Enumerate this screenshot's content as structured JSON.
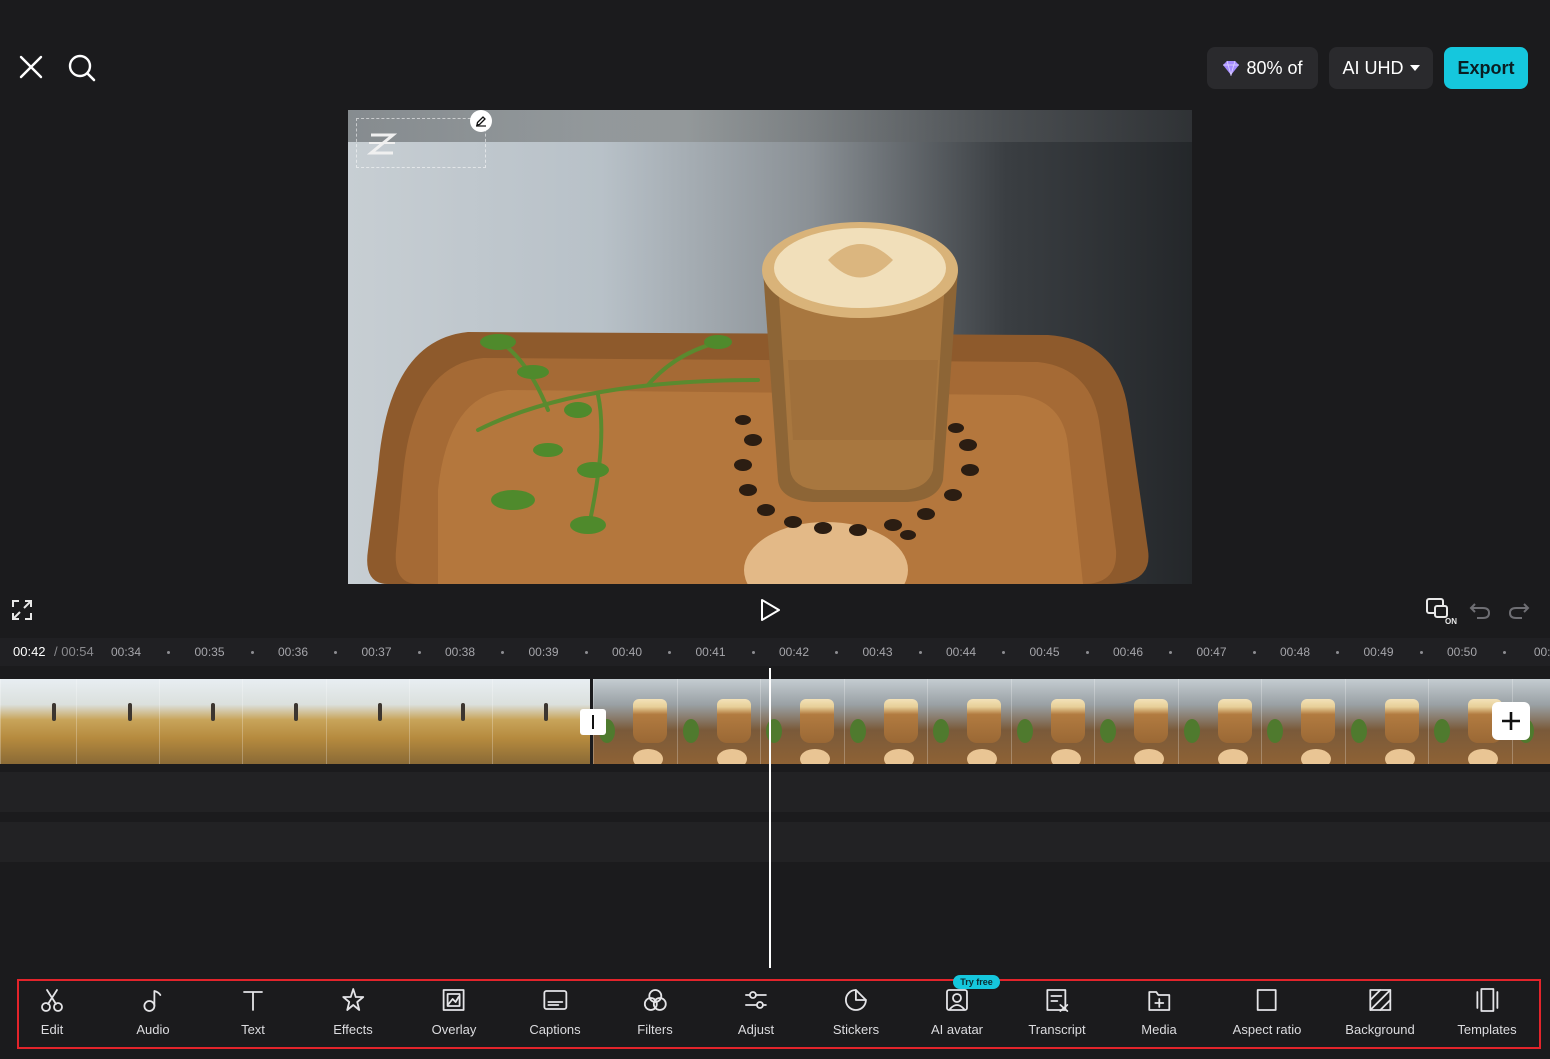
{
  "topbar": {
    "credits_label": "80% of",
    "quality_label": "AI UHD",
    "export_label": "Export",
    "colors": {
      "export_bg": "#15c7dd",
      "credit_gem": "#a58cff"
    }
  },
  "preview": {
    "description_icon": "capcut-logo-icon"
  },
  "timeline": {
    "current_time": "00:42",
    "total_time": "/ 00:54",
    "ticks": [
      "00:34",
      "00:35",
      "00:36",
      "00:37",
      "00:38",
      "00:39",
      "00:40",
      "00:41",
      "00:42",
      "00:43",
      "00:44",
      "00:45",
      "00:46",
      "00:47",
      "00:48",
      "00:49",
      "00:50",
      "00:5"
    ]
  },
  "toolbar": {
    "try_free_badge": "Try free",
    "items": [
      {
        "label": "Edit",
        "icon": "scissors-icon"
      },
      {
        "label": "Audio",
        "icon": "music-note-icon"
      },
      {
        "label": "Text",
        "icon": "text-icon"
      },
      {
        "label": "Effects",
        "icon": "effects-star-icon"
      },
      {
        "label": "Overlay",
        "icon": "overlay-icon"
      },
      {
        "label": "Captions",
        "icon": "captions-icon"
      },
      {
        "label": "Filters",
        "icon": "filters-icon"
      },
      {
        "label": "Adjust",
        "icon": "adjust-sliders-icon"
      },
      {
        "label": "Stickers",
        "icon": "stickers-icon"
      },
      {
        "label": "AI avatar",
        "icon": "ai-avatar-icon"
      },
      {
        "label": "Transcript",
        "icon": "transcript-icon"
      },
      {
        "label": "Media",
        "icon": "media-icon"
      },
      {
        "label": "Aspect ratio",
        "icon": "aspect-ratio-icon"
      },
      {
        "label": "Background",
        "icon": "background-icon"
      },
      {
        "label": "Templates",
        "icon": "templates-icon"
      }
    ]
  }
}
